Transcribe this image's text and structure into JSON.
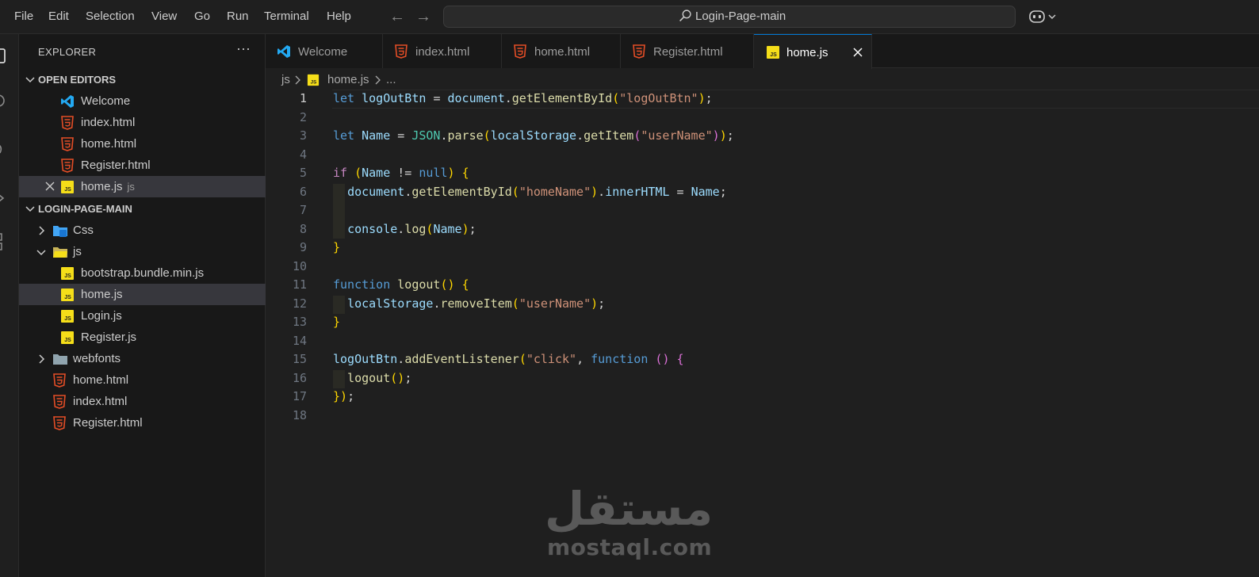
{
  "menu": [
    "File",
    "Edit",
    "Selection",
    "View",
    "Go",
    "Run",
    "Terminal",
    "Help"
  ],
  "search": {
    "text": "Login-Page-main"
  },
  "sidebar": {
    "title": "EXPLORER",
    "more": "···",
    "open_editors": {
      "header": "OPEN EDITORS",
      "items": [
        {
          "name": "Welcome",
          "icon": "vscode-icon"
        },
        {
          "name": "index.html",
          "icon": "html-icon"
        },
        {
          "name": "home.html",
          "icon": "html-icon"
        },
        {
          "name": "Register.html",
          "icon": "html-icon"
        },
        {
          "name": "home.js",
          "desc": "js",
          "icon": "js-icon"
        }
      ]
    },
    "project": {
      "header": "LOGIN-PAGE-MAIN",
      "items": [
        {
          "name": "Css",
          "icon": "css-folder-icon",
          "expanded": false
        },
        {
          "name": "js",
          "icon": "js-folder-icon",
          "expanded": true
        },
        {
          "name": "bootstrap.bundle.min.js",
          "icon": "js-icon"
        },
        {
          "name": "home.js",
          "icon": "js-icon"
        },
        {
          "name": "Login.js",
          "icon": "js-icon"
        },
        {
          "name": "Register.js",
          "icon": "js-icon"
        },
        {
          "name": "webfonts",
          "icon": "folder-icon",
          "expanded": false
        },
        {
          "name": "home.html",
          "icon": "html-icon"
        },
        {
          "name": "index.html",
          "icon": "html-icon"
        },
        {
          "name": "Register.html",
          "icon": "html-icon"
        }
      ]
    }
  },
  "tabs": [
    {
      "label": "Welcome",
      "icon": "vscode-icon"
    },
    {
      "label": "index.html",
      "icon": "html-icon"
    },
    {
      "label": "home.html",
      "icon": "html-icon"
    },
    {
      "label": "Register.html",
      "icon": "html-icon"
    },
    {
      "label": "home.js",
      "icon": "js-icon",
      "active": true
    }
  ],
  "breadcrumb": {
    "folder": "js",
    "file": "home.js",
    "more": "..."
  },
  "editor": {
    "active_line": 1,
    "line_numbers": [
      "1",
      "2",
      "3",
      "4",
      "5",
      "6",
      "7",
      "8",
      "9",
      "10",
      "11",
      "12",
      "13",
      "14",
      "15",
      "16",
      "17",
      "18"
    ],
    "lines": [
      "let logOutBtn = document.getElementById(\"logOutBtn\");",
      "",
      "let Name = JSON.parse(localStorage.getItem(\"userName\"));",
      "",
      "if (Name != null) {",
      "  document.getElementById(\"homeName\").innerHTML = Name;",
      "",
      "  console.log(Name);",
      "}",
      "",
      "function logout() {",
      "  localStorage.removeItem(\"userName\");",
      "}",
      "",
      "logOutBtn.addEventListener(\"click\", function () {",
      "  logout();",
      "});",
      ""
    ]
  },
  "watermark": {
    "arabic": "مستقل",
    "latin": "mostaql.com"
  },
  "colors": {
    "accent": "#0078d4",
    "html": "#e44d26",
    "js": "#f5de19",
    "vscode": "#23a9f2",
    "css": "#42a5f5"
  }
}
